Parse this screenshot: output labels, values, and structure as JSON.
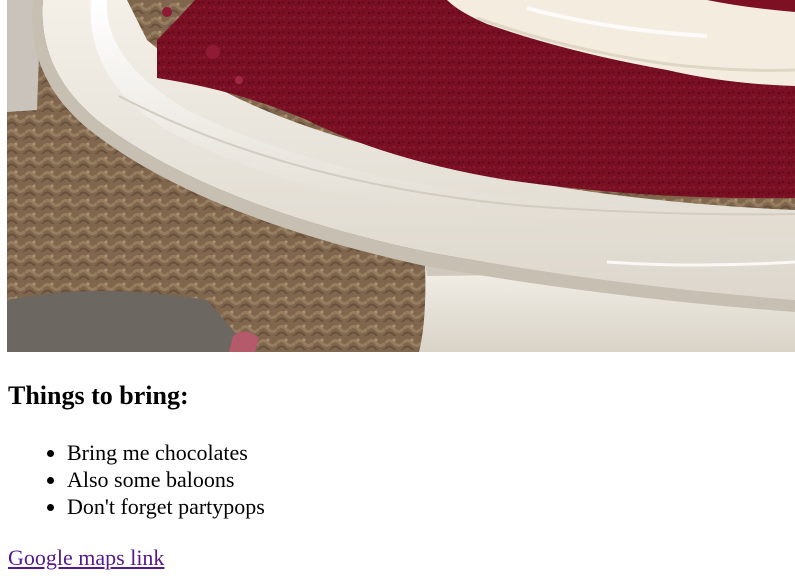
{
  "hero_image": {
    "icon": "red-velvet-cake-photo",
    "colors": {
      "cake": "#7e1024",
      "frosting": "#f3ecdf",
      "plate": "#ebe6dd",
      "basket": "#7f664c"
    }
  },
  "content": {
    "heading": "Things to bring:",
    "items": [
      "Bring me chocolates",
      "Also some baloons",
      "Don't forget partypops"
    ],
    "link": {
      "label": "Google maps link",
      "color": "#551a8b"
    }
  }
}
